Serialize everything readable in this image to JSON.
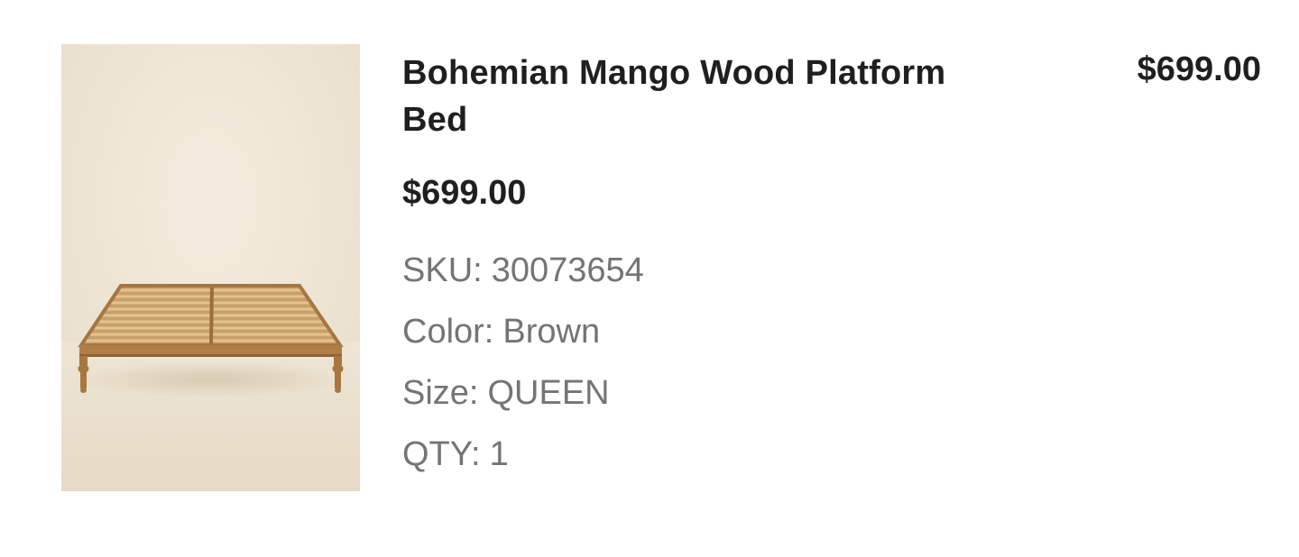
{
  "line_item": {
    "product_name": "Bohemian Mango Wood Platform Bed",
    "unit_price": "$699.00",
    "line_total": "$699.00",
    "image_alt": "Wooden slatted platform bed frame with turned legs",
    "attributes": {
      "sku": {
        "label": "SKU:",
        "value": "30073654"
      },
      "color": {
        "label": "Color:",
        "value": "Brown"
      },
      "size": {
        "label": "Size:",
        "value": "QUEEN"
      },
      "qty": {
        "label": "QTY:",
        "value": "1"
      }
    }
  },
  "colors": {
    "text_primary": "#1f1f1f",
    "text_secondary": "#747474",
    "image_background": "#ece3d3",
    "wood": "#b98a4e"
  }
}
